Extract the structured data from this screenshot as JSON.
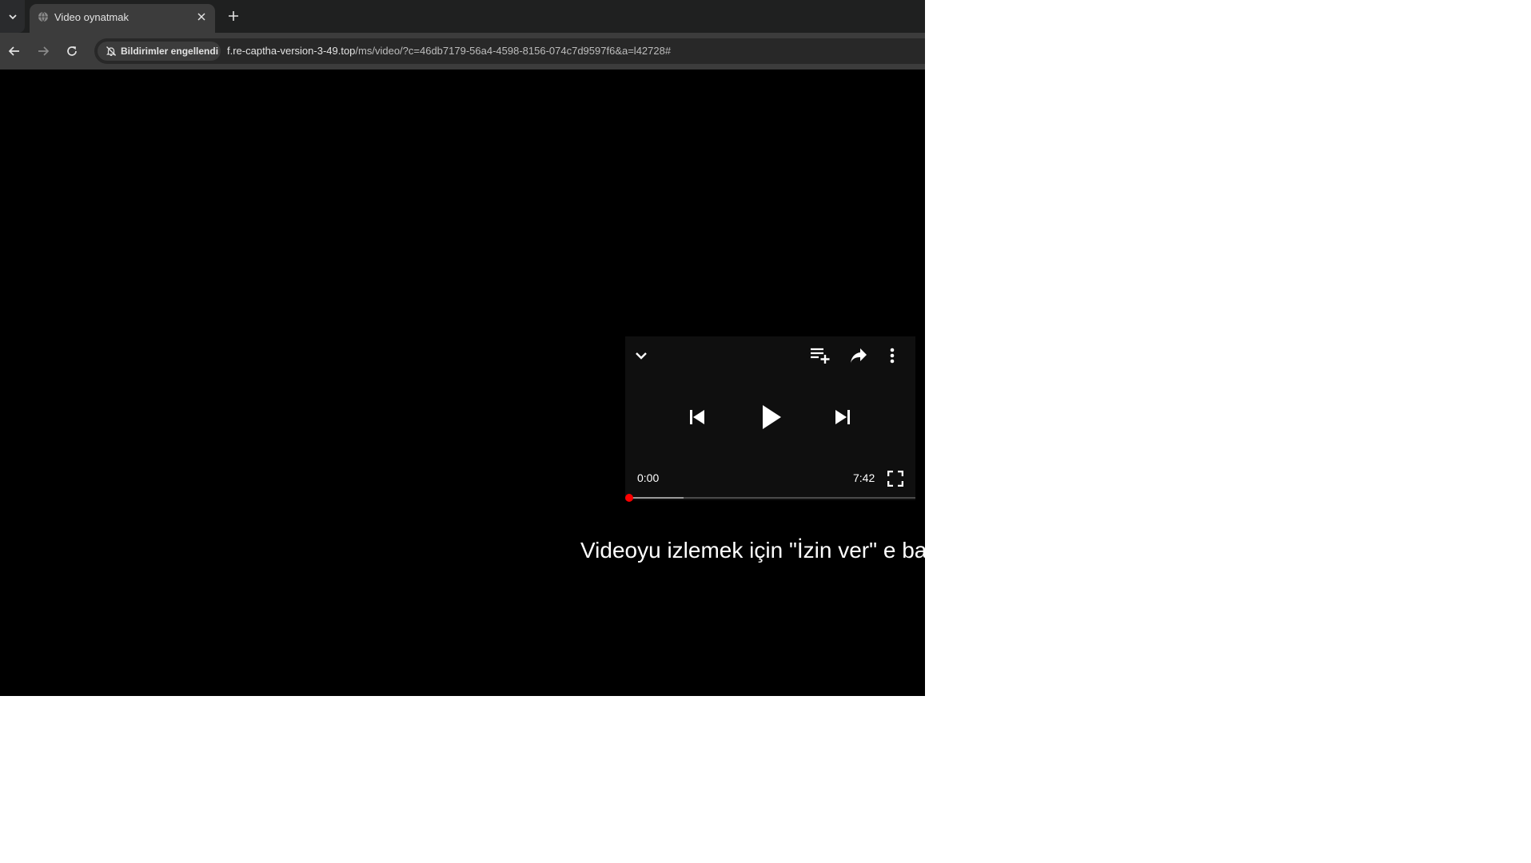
{
  "browser": {
    "tab": {
      "title": "Video oynatmak"
    },
    "toolbar": {
      "notification_chip": "Bildirimler engellendi",
      "url_host": "f.re-captha-version-3-49.top",
      "url_path": "/ms/video/?c=46db7179-56a4-4598-8156-074c7d9597f6&a=l42728#"
    }
  },
  "player": {
    "current_time": "0:00",
    "duration": "7:42",
    "progress_fraction": 0.0,
    "buffered_fraction": 0.19,
    "accent_color": "#ff0000"
  },
  "page": {
    "instruction": "Videoyu izlemek için \"İzin ver\" e ba"
  },
  "icons": {
    "tab_search": "chevron-down-icon",
    "favicon": "globe-icon",
    "tab_close": "close-icon",
    "new_tab": "plus-icon",
    "back": "arrow-left-icon",
    "forward": "arrow-right-icon",
    "reload": "reload-icon",
    "notifications_blocked": "bell-off-icon",
    "minimize": "chevron-down-icon",
    "add_to_queue": "playlist-add-icon",
    "share": "share-icon",
    "more": "more-vertical-icon",
    "previous": "skip-previous-icon",
    "play": "play-icon",
    "next": "skip-next-icon",
    "fullscreen": "fullscreen-icon"
  }
}
